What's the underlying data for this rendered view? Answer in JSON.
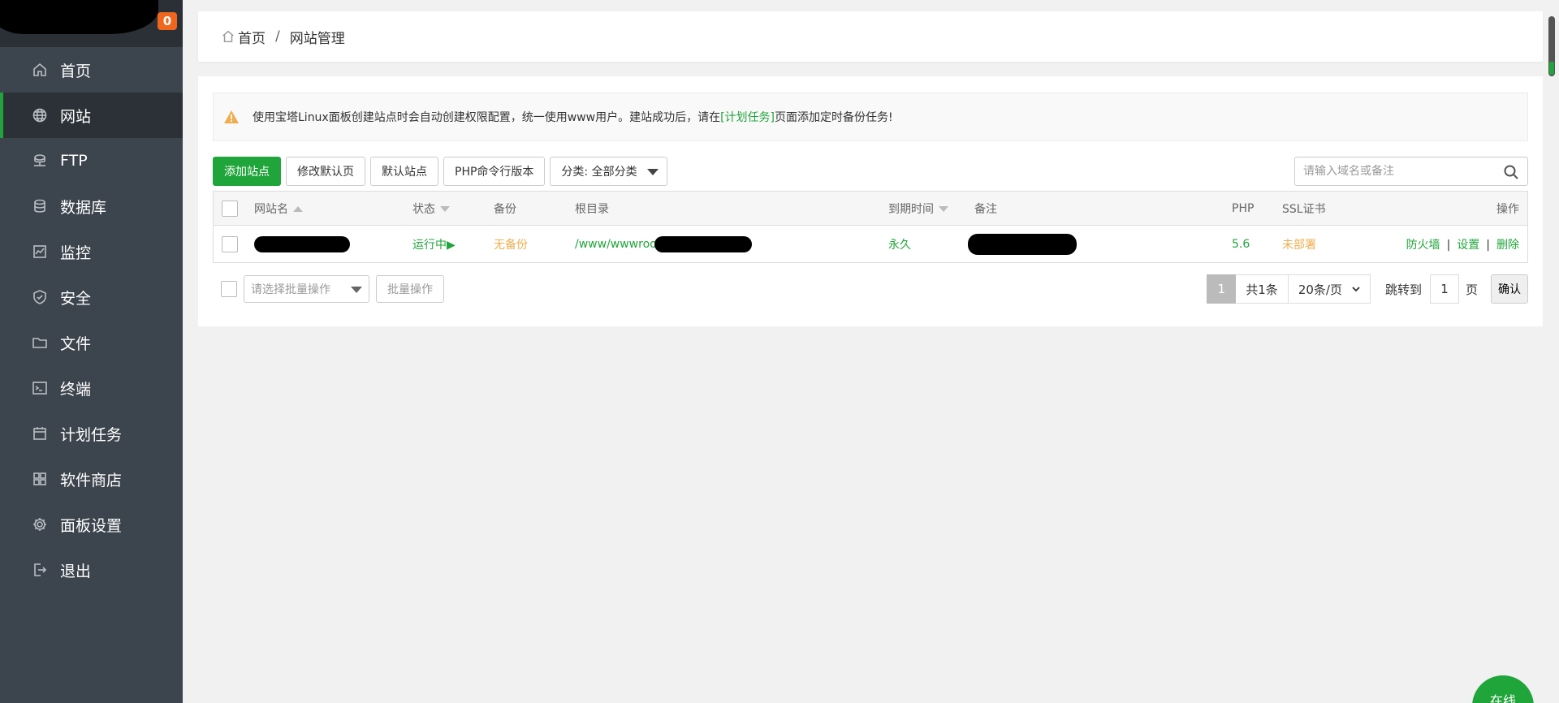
{
  "sidebar": {
    "badge_count": "0",
    "items": [
      {
        "label": "首页",
        "icon": "home-icon"
      },
      {
        "label": "网站",
        "icon": "globe-icon",
        "active": true
      },
      {
        "label": "FTP",
        "icon": "ftp-icon"
      },
      {
        "label": "数据库",
        "icon": "database-icon"
      },
      {
        "label": "监控",
        "icon": "monitor-icon"
      },
      {
        "label": "安全",
        "icon": "shield-icon"
      },
      {
        "label": "文件",
        "icon": "folder-icon"
      },
      {
        "label": "终端",
        "icon": "terminal-icon"
      },
      {
        "label": "计划任务",
        "icon": "calendar-icon"
      },
      {
        "label": "软件商店",
        "icon": "apps-icon"
      },
      {
        "label": "面板设置",
        "icon": "settings-icon"
      },
      {
        "label": "退出",
        "icon": "logout-icon"
      }
    ]
  },
  "breadcrumb": {
    "home": "首页",
    "separator": "/",
    "current": "网站管理"
  },
  "alert": {
    "text_before": "使用宝塔Linux面板创建站点时会自动创建权限配置，统一使用www用户。建站成功后，请在",
    "link": "[计划任务]",
    "text_after": "页面添加定时备份任务!"
  },
  "toolbar": {
    "add_site": "添加站点",
    "modify_default": "修改默认页",
    "default_site": "默认站点",
    "php_cli": "PHP命令行版本",
    "category": "分类: 全部分类",
    "search_placeholder": "请输入域名或备注"
  },
  "table": {
    "headers": {
      "name": "网站名",
      "status": "状态",
      "backup": "备份",
      "root": "根目录",
      "expire": "到期时间",
      "remark": "备注",
      "php": "PHP",
      "ssl": "SSL证书",
      "ops": "操作"
    },
    "rows": [
      {
        "status": "运行中▶",
        "backup": "无备份",
        "root": "/www/wwwroot",
        "expire": "永久",
        "php": "5.6",
        "ssl": "未部署",
        "op_firewall": "防火墙",
        "op_settings": "设置",
        "op_delete": "删除"
      }
    ]
  },
  "footer": {
    "batch_placeholder": "请选择批量操作",
    "batch_button": "批量操作",
    "current_page": "1",
    "total": "共1条",
    "per_page": "20条/页",
    "jump_label": "跳转到",
    "jump_value": "1",
    "page_unit": "页",
    "confirm": "确认"
  },
  "online_button": "在线",
  "colors": {
    "accent": "#20a53a",
    "warning": "#f0ad4e",
    "sidebar_bg": "#3c444d",
    "badge": "#f0661d"
  }
}
